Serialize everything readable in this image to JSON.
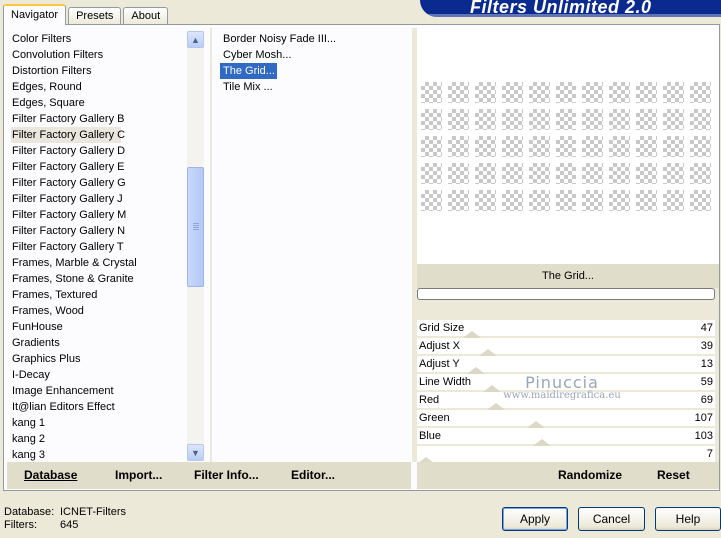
{
  "tabs": [
    {
      "label": "Navigator",
      "active": true
    },
    {
      "label": "Presets",
      "active": false
    },
    {
      "label": "About",
      "active": false
    }
  ],
  "header": {
    "title": "Filters Unlimited 2.0"
  },
  "categories": [
    "Color Filters",
    "Convolution Filters",
    "Distortion Filters",
    "Edges, Round",
    "Edges, Square",
    "Filter Factory Gallery B",
    "Filter Factory Gallery C",
    "Filter Factory Gallery D",
    "Filter Factory Gallery E",
    "Filter Factory Gallery G",
    "Filter Factory Gallery J",
    "Filter Factory Gallery M",
    "Filter Factory Gallery N",
    "Filter Factory Gallery T",
    "Frames, Marble & Crystal",
    "Frames, Stone & Granite",
    "Frames, Textured",
    "Frames, Wood",
    "FunHouse",
    "Gradients",
    "Graphics Plus",
    "I-Decay",
    "Image Enhancement",
    "It@lian Editors Effect",
    "kang 1",
    "kang 2",
    "kang 3"
  ],
  "selected_category": "Filter Factory Gallery C",
  "filters": [
    "Border Noisy Fade III...",
    "Cyber Mosh...",
    "The Grid...",
    "Tile Mix ..."
  ],
  "selected_filter": "The Grid...",
  "preview": {
    "filter_name": "The Grid...",
    "grid_color": "#46706c"
  },
  "params": [
    {
      "name": "Grid Size",
      "value": "47"
    },
    {
      "name": "Adjust X",
      "value": "39"
    },
    {
      "name": "Adjust Y",
      "value": "13"
    },
    {
      "name": "Line Width",
      "value": "59"
    },
    {
      "name": "Red",
      "value": "69"
    },
    {
      "name": "Green",
      "value": "107"
    },
    {
      "name": "Blue",
      "value": "103"
    },
    {
      "name": "",
      "value": "7"
    }
  ],
  "watermark": {
    "line1": "Pinuccia",
    "line2": "www.maidiregrafica.eu"
  },
  "left_buttons": {
    "database": "Database",
    "import": "Import...",
    "filter_info": "Filter Info...",
    "editor": "Editor..."
  },
  "right_buttons": {
    "randomize": "Randomize",
    "reset": "Reset"
  },
  "status": {
    "db_label": "Database:",
    "db_value": "ICNET-Filters",
    "filters_label": "Filters:",
    "filters_value": "645"
  },
  "dialog_buttons": {
    "apply": "Apply",
    "cancel": "Cancel",
    "help": "Help"
  }
}
